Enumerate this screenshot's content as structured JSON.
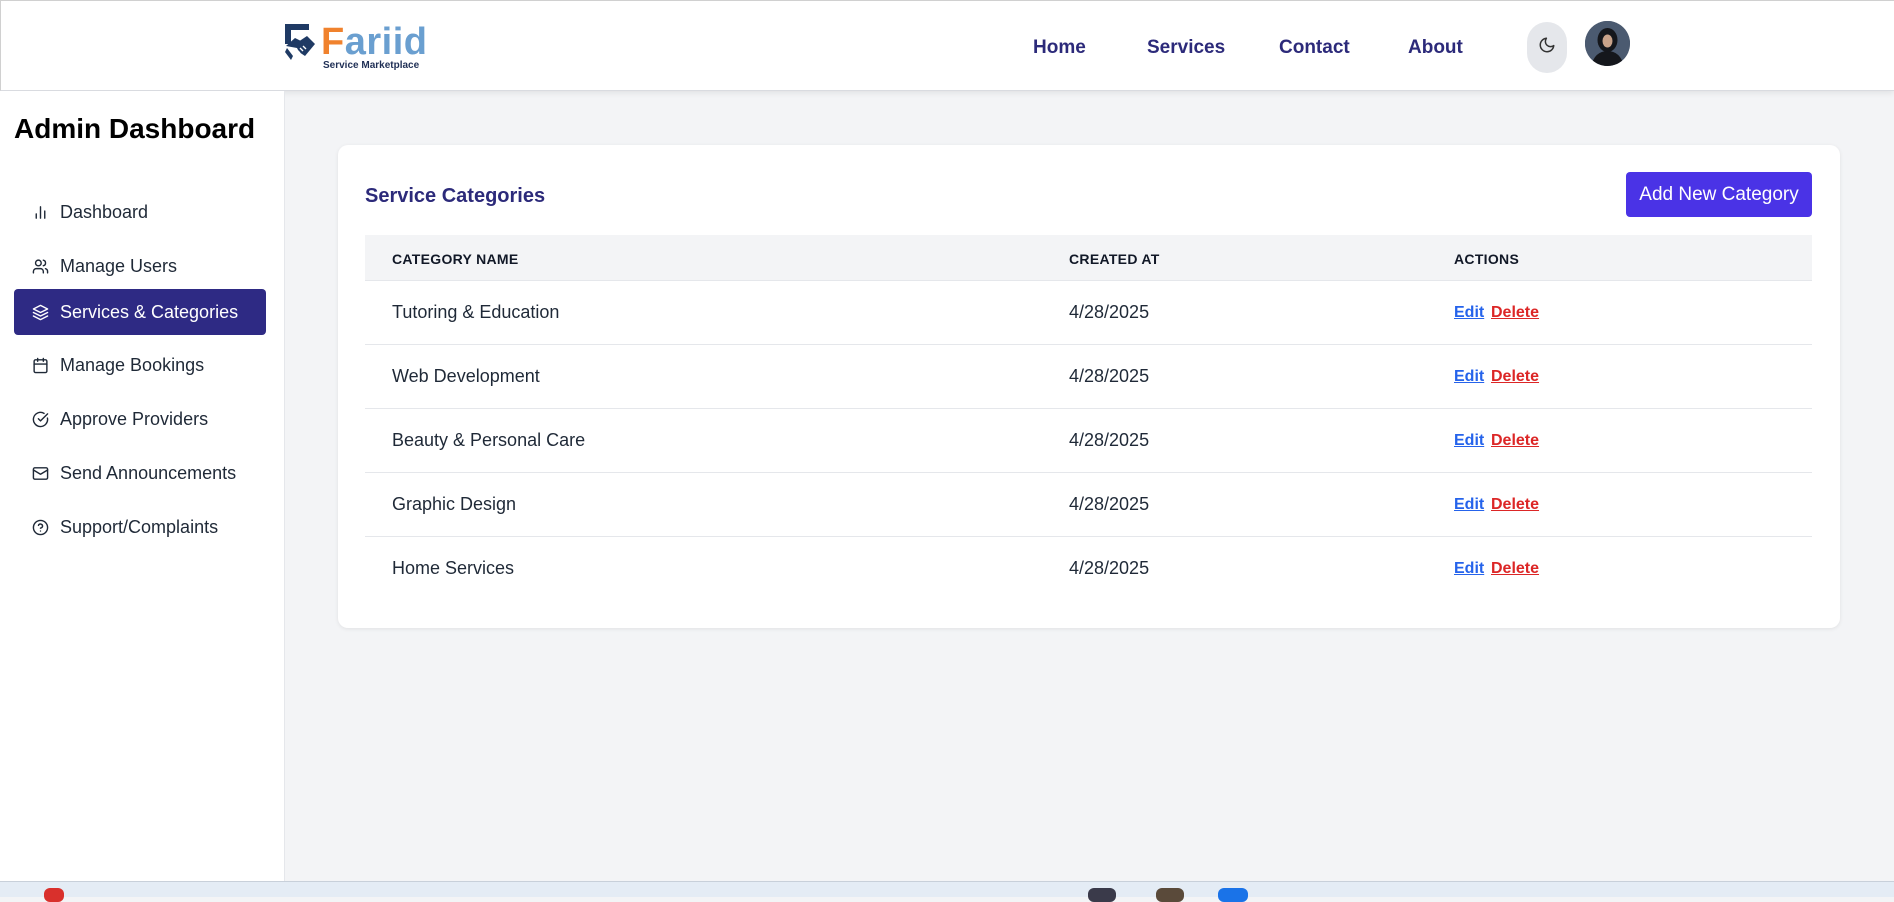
{
  "header": {
    "logo_name_f": "F",
    "logo_name_rest": "ariid",
    "logo_tagline": "Service Marketplace",
    "nav": [
      {
        "label": "Home"
      },
      {
        "label": "Services"
      },
      {
        "label": "Contact"
      },
      {
        "label": "About"
      }
    ],
    "theme_icon": "moon-icon",
    "avatar_icon": "user-avatar"
  },
  "sidebar": {
    "title": "Admin Dashboard",
    "items": [
      {
        "label": "Dashboard",
        "icon": "bar-chart-icon",
        "active": false
      },
      {
        "label": "Manage Users",
        "icon": "users-icon",
        "active": false
      },
      {
        "label": "Services & Categories",
        "icon": "layers-icon",
        "active": true
      },
      {
        "label": "Manage Bookings",
        "icon": "calendar-icon",
        "active": false
      },
      {
        "label": "Approve Providers",
        "icon": "check-circle-icon",
        "active": false
      },
      {
        "label": "Send Announcements",
        "icon": "mail-icon",
        "active": false
      },
      {
        "label": "Support/Complaints",
        "icon": "help-circle-icon",
        "active": false
      }
    ]
  },
  "main": {
    "title": "Service Categories",
    "add_button": "Add New Category",
    "columns": [
      "CATEGORY NAME",
      "CREATED AT",
      "ACTIONS"
    ],
    "rows": [
      {
        "name": "Tutoring & Education",
        "created": "4/28/2025",
        "edit": "Edit",
        "delete": "Delete"
      },
      {
        "name": "Web Development",
        "created": "4/28/2025",
        "edit": "Edit",
        "delete": "Delete"
      },
      {
        "name": "Beauty & Personal Care",
        "created": "4/28/2025",
        "edit": "Edit",
        "delete": "Delete"
      },
      {
        "name": "Graphic Design",
        "created": "4/28/2025",
        "edit": "Edit",
        "delete": "Delete"
      },
      {
        "name": "Home Services",
        "created": "4/28/2025",
        "edit": "Edit",
        "delete": "Delete"
      }
    ]
  },
  "colors": {
    "brand_orange": "#f0822d",
    "brand_blue": "#6a9fd0",
    "nav_text": "#2c2a7a",
    "active_sidebar": "#2e2a84",
    "primary_button": "#4a33e6",
    "edit_link": "#2563eb",
    "delete_link": "#dc2626"
  }
}
